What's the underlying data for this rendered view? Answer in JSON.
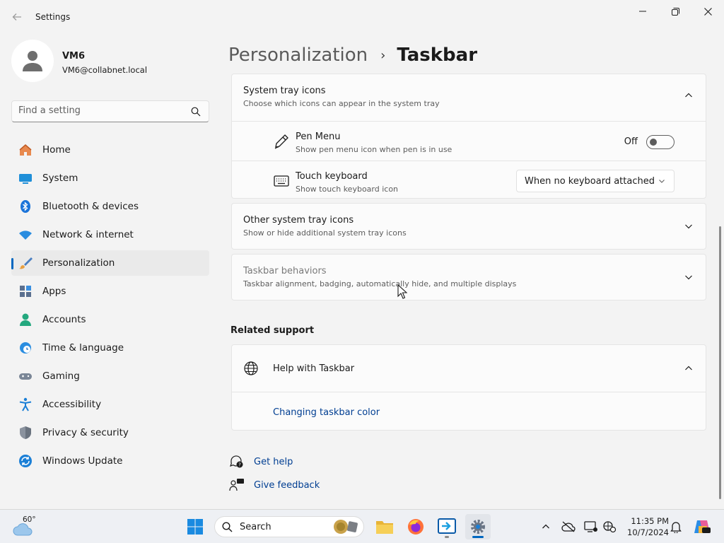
{
  "window": {
    "title": "Settings"
  },
  "profile": {
    "name": "VM6",
    "email": "VM6@collabnet.local"
  },
  "search": {
    "placeholder": "Find a setting"
  },
  "sidebar": {
    "items": [
      {
        "label": "Home",
        "icon": "home-icon"
      },
      {
        "label": "System",
        "icon": "system-icon"
      },
      {
        "label": "Bluetooth & devices",
        "icon": "bluetooth-icon"
      },
      {
        "label": "Network & internet",
        "icon": "wifi-icon"
      },
      {
        "label": "Personalization",
        "icon": "brush-icon",
        "active": true
      },
      {
        "label": "Apps",
        "icon": "apps-icon"
      },
      {
        "label": "Accounts",
        "icon": "person-icon"
      },
      {
        "label": "Time & language",
        "icon": "clock-globe-icon"
      },
      {
        "label": "Gaming",
        "icon": "gamepad-icon"
      },
      {
        "label": "Accessibility",
        "icon": "accessibility-icon"
      },
      {
        "label": "Privacy & security",
        "icon": "shield-icon"
      },
      {
        "label": "Windows Update",
        "icon": "update-icon"
      }
    ]
  },
  "breadcrumb": {
    "parent": "Personalization",
    "separator": "›",
    "current": "Taskbar"
  },
  "system_tray": {
    "title": "System tray icons",
    "subtitle": "Choose which icons can appear in the system tray",
    "pen_menu": {
      "title": "Pen Menu",
      "subtitle": "Show pen menu icon when pen is in use",
      "state_label": "Off",
      "on": false
    },
    "touch_keyboard": {
      "title": "Touch keyboard",
      "subtitle": "Show touch keyboard icon",
      "selected": "When no keyboard attached"
    }
  },
  "other_tray": {
    "title": "Other system tray icons",
    "subtitle": "Show or hide additional system tray icons"
  },
  "behaviors": {
    "title": "Taskbar behaviors",
    "subtitle": "Taskbar alignment, badging, automatically hide, and multiple displays"
  },
  "related": {
    "title": "Related support",
    "help_title": "Help with Taskbar",
    "link": "Changing taskbar color"
  },
  "footer": {
    "get_help": "Get help",
    "give_feedback": "Give feedback"
  },
  "taskbar": {
    "temperature": "60°",
    "search_label": "Search",
    "time": "11:35 PM",
    "date": "10/7/2024"
  },
  "colors": {
    "accent": "#0067c0",
    "link": "#003e92"
  }
}
